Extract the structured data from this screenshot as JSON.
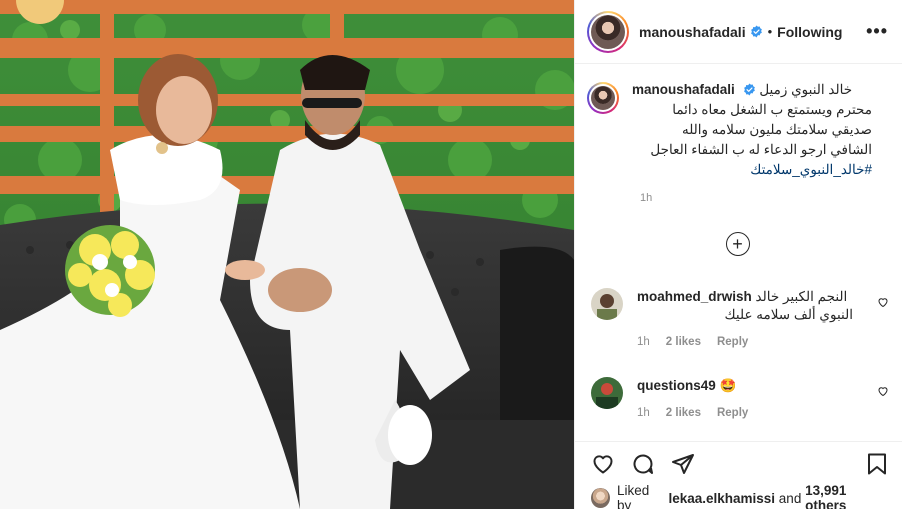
{
  "post": {
    "username": "manoushafadali",
    "follow_status": "Following",
    "dot": "•",
    "more_label": "•••",
    "caption_lines": [
      "خالد النبوي زميل",
      "محترم ويستمتع ب الشغل معاه دائما",
      "صديقي سلامتك مليون سلامه والله",
      "الشافي ارجو الدعاء له ب الشفاء العاجل"
    ],
    "hashtag": "#خالد_النبوي_سلامتك",
    "caption_time": "1h",
    "load_more_label": "+"
  },
  "comments": [
    {
      "username": "moahmed_drwish",
      "text_line1": "النجم الكبير خالد",
      "text_line2": "النبوي ألف سلامه عليك",
      "time": "1h",
      "likes": "2 likes",
      "reply": "Reply"
    },
    {
      "username": "questions49",
      "emoji": "🤩",
      "time": "1h",
      "likes": "2 likes",
      "reply": "Reply"
    }
  ],
  "footer": {
    "liked_prefix": "Liked by",
    "liked_user": "lekaa.elkhamissi",
    "liked_and": "and",
    "liked_count": "13,991 others"
  },
  "colors": {
    "verified": "#3897f0",
    "hashtag": "#00376b",
    "muted": "#8e8e8e"
  },
  "icons": [
    "verified-badge-icon",
    "more-options-icon",
    "plus-circle-icon",
    "heart-icon",
    "comment-icon",
    "share-icon",
    "save-icon"
  ]
}
